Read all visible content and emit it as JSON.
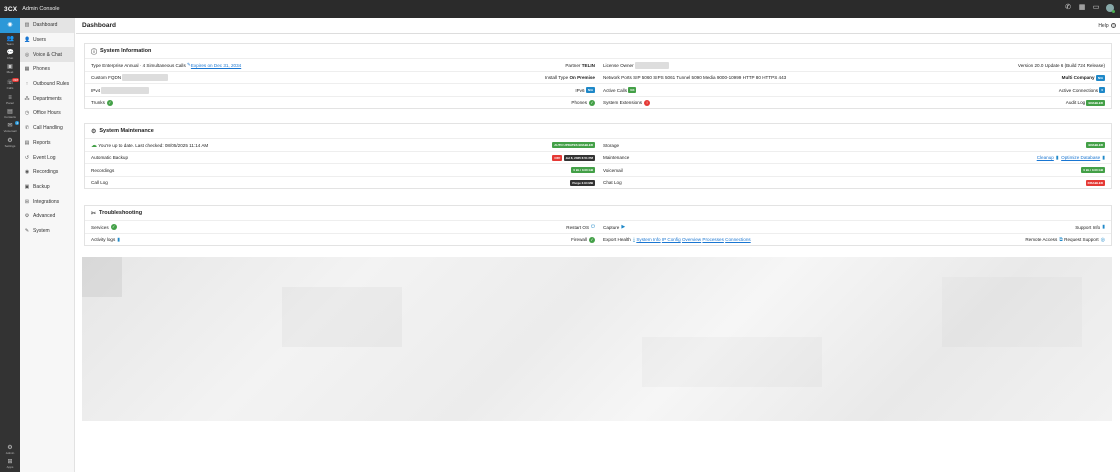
{
  "app": {
    "logo": "3CX",
    "title": "Admin Console"
  },
  "rail": [
    {
      "label": "",
      "icon": "logo-icon"
    },
    {
      "label": "Team",
      "icon": "team-icon"
    },
    {
      "label": "Chat",
      "icon": "chat-icon"
    },
    {
      "label": "Meet",
      "icon": "meet-icon"
    },
    {
      "label": "Calls",
      "icon": "calls-icon",
      "badge": "338"
    },
    {
      "label": "Panel",
      "icon": "panel-icon"
    },
    {
      "label": "Contacts",
      "icon": "contacts-icon"
    },
    {
      "label": "Voicemail",
      "icon": "voicemail-icon",
      "badge": "4"
    },
    {
      "label": "Settings",
      "icon": "settings-icon"
    },
    {
      "label": "Admin",
      "icon": "admin-icon"
    },
    {
      "label": "Apps",
      "icon": "apps-icon"
    }
  ],
  "nav": [
    {
      "label": "Dashboard",
      "icon": "dashboard-icon"
    },
    {
      "label": "Users",
      "icon": "users-icon"
    },
    {
      "label": "Voice & Chat",
      "icon": "voice-chat-icon"
    },
    {
      "label": "Phones",
      "icon": "phones-icon"
    },
    {
      "label": "Outbound Rules",
      "icon": "outbound-rules-icon"
    },
    {
      "label": "Departments",
      "icon": "departments-icon"
    },
    {
      "label": "Office Hours",
      "icon": "office-hours-icon"
    },
    {
      "label": "Call Handling",
      "icon": "call-handling-icon"
    },
    {
      "label": "Reports",
      "icon": "reports-icon"
    },
    {
      "label": "Event Log",
      "icon": "event-log-icon"
    },
    {
      "label": "Recordings",
      "icon": "recordings-icon"
    },
    {
      "label": "Backup",
      "icon": "backup-icon"
    },
    {
      "label": "Integrations",
      "icon": "integrations-icon"
    },
    {
      "label": "Advanced",
      "icon": "advanced-icon"
    },
    {
      "label": "System",
      "icon": "system-icon"
    }
  ],
  "header": {
    "title": "Dashboard",
    "help": "Help"
  },
  "sysinfo": {
    "title": "System Information",
    "type_label": "Type",
    "type_value": "Enterprise Annual · 4 Simultaneous Calls",
    "expires": "Expires on Dec 31, 2034",
    "partner_label": "Partner",
    "partner_value": "TELIN",
    "license_label": "License Owner",
    "version": "Version 20.0 Update 6 (Build 724 Release)",
    "fqdn_label": "Custom FQDN",
    "install_label": "Install Type",
    "install_value": "On Premise",
    "ports_label": "Network Ports",
    "ports": "SIP 5060 SIPS 5061 Tunnel 5090 Media 9000-10999 HTTP 80 HTTPS 443",
    "company": "Multi Company",
    "company_badge": "N/A",
    "ipv4_label": "IPv4",
    "ipv6_label": "IPv6",
    "ipv6_badge": "N/A",
    "active_calls_label": "Active Calls",
    "active_calls_badge": "0/4",
    "active_conn_label": "Active Connections",
    "active_conn_value": "0",
    "trunks_label": "Trunks",
    "phones_label": "Phones",
    "extensions_label": "System Extensions",
    "audit_label": "Audit Log",
    "audit_badge": "ENABLED"
  },
  "maint": {
    "title": "System Maintenance",
    "uptodate": "You're up to date. Last checked: 08/05/2025 11:14 AM",
    "autoupdate_badge": "AUTO UPDATES ENABLED",
    "storage_label": "Storage",
    "storage_badge": "ENABLED",
    "backup_label": "Automatic Backup",
    "backup_badge1": "OFF",
    "backup_badge2": "Jul 8, 2025 6:51 PM",
    "maintenance_label": "Maintenance",
    "cleanup": "Cleanup",
    "optimize": "Optimize Database",
    "recordings_label": "Recordings",
    "recordings_badge": "0 kb / 0.00 GB",
    "voicemail_label": "Voicemail",
    "voicemail_badge": "0 kb / 0.00 GB",
    "calllog_label": "Call Log",
    "calllog_badge": "Purge 2.94 MB",
    "chatlog_label": "Chat Log",
    "chatlog_badge": "DISABLED"
  },
  "trouble": {
    "title": "Troubleshooting",
    "services_label": "Services",
    "restart_label": "Restart OS",
    "capture_label": "Capture",
    "support_label": "Support Info",
    "activity_label": "Activity logs",
    "firewall_label": "Firewall",
    "export_label": "Export Health",
    "export_links": [
      "System Info",
      "IP Config",
      "Overview",
      "Processes",
      "Connections"
    ],
    "remote_label": "Remote Access",
    "request_label": "Request Support"
  }
}
